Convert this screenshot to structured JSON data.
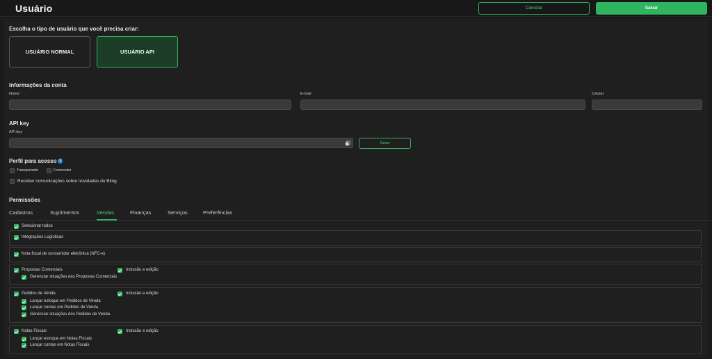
{
  "header": {
    "title": "Usuário",
    "cancel_label": "Cancelar",
    "save_label": "Salvar"
  },
  "user_type": {
    "prompt": "Escolha o tipo de usuário que você precisa criar:",
    "options": [
      {
        "label": "USUÁRIO NORMAL",
        "selected": false
      },
      {
        "label": "USUÁRIO API",
        "selected": true
      }
    ]
  },
  "account": {
    "heading": "Informações da conta",
    "name_label": "Nome",
    "required_mark": "*",
    "email_label": "E-mail",
    "phone_label": "Celular",
    "name_value": "",
    "email_value": "",
    "phone_value": ""
  },
  "api_key": {
    "heading": "API key",
    "label": "API key",
    "value": "",
    "generate_label": "Gerar"
  },
  "profile": {
    "heading": "Perfil para acesso",
    "info_glyph": "i",
    "options": [
      {
        "label": "Transportador",
        "checked": false
      },
      {
        "label": "Fornecedor",
        "checked": false
      }
    ],
    "newsletter_label": "Receber comunicações sobre novidades do Bling",
    "newsletter_checked": false
  },
  "permissions": {
    "heading": "Permissões",
    "tabs": [
      "Cadastros",
      "Suprimentos",
      "Vendas",
      "Finanças",
      "Serviços",
      "Preferências"
    ],
    "active_tab": "Vendas",
    "select_all": "Selecionar todos",
    "groups": [
      {
        "label": "Integrações Logísticas"
      },
      {
        "label": "Nota fiscal de consumidor eletrônica (NFC-e)"
      },
      {
        "label": "Propostas Comerciais",
        "side": "Inclusão e edição",
        "children": [
          "Gerenciar situações das Propostas Comerciais"
        ]
      },
      {
        "label": "Pedidos de Venda",
        "side": "Inclusão e edição",
        "children": [
          "Lançar estoque em Pedidos de Venda",
          "Lançar contas em Pedidos de Venda",
          "Gerenciar situações dos Pedidos de Venda"
        ]
      },
      {
        "label": "Notas Fiscais",
        "side": "Inclusão e edição",
        "children": [
          "Lançar estoque em Notas Fiscais",
          "Lançar contas em Notas Fiscais"
        ]
      }
    ]
  },
  "colors": {
    "accent": "#2fb55f",
    "background": "#1b1b1b",
    "info": "#2f8fd8"
  }
}
